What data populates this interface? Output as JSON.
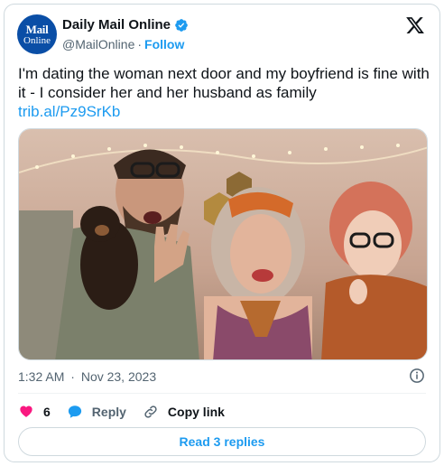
{
  "account": {
    "logo_line1": "Mail",
    "logo_line2": "Online",
    "display_name": "Daily Mail Online",
    "handle": "@MailOnline",
    "separator": "·",
    "follow_label": "Follow"
  },
  "tweet": {
    "text": "I'm dating the woman next door and my boyfriend is fine with it - I consider her and her husband as family",
    "link": "trib.al/Pz9SrKb",
    "time": "1:32 AM",
    "date": "Nov 23, 2023",
    "dot": "·"
  },
  "actions": {
    "like_count": "6",
    "reply_label": "Reply",
    "copy_link_label": "Copy link"
  },
  "read_replies_label": "Read 3 replies",
  "colors": {
    "accent": "#1d9bf0",
    "like": "#f91880",
    "brand": "#0a4ea6"
  }
}
